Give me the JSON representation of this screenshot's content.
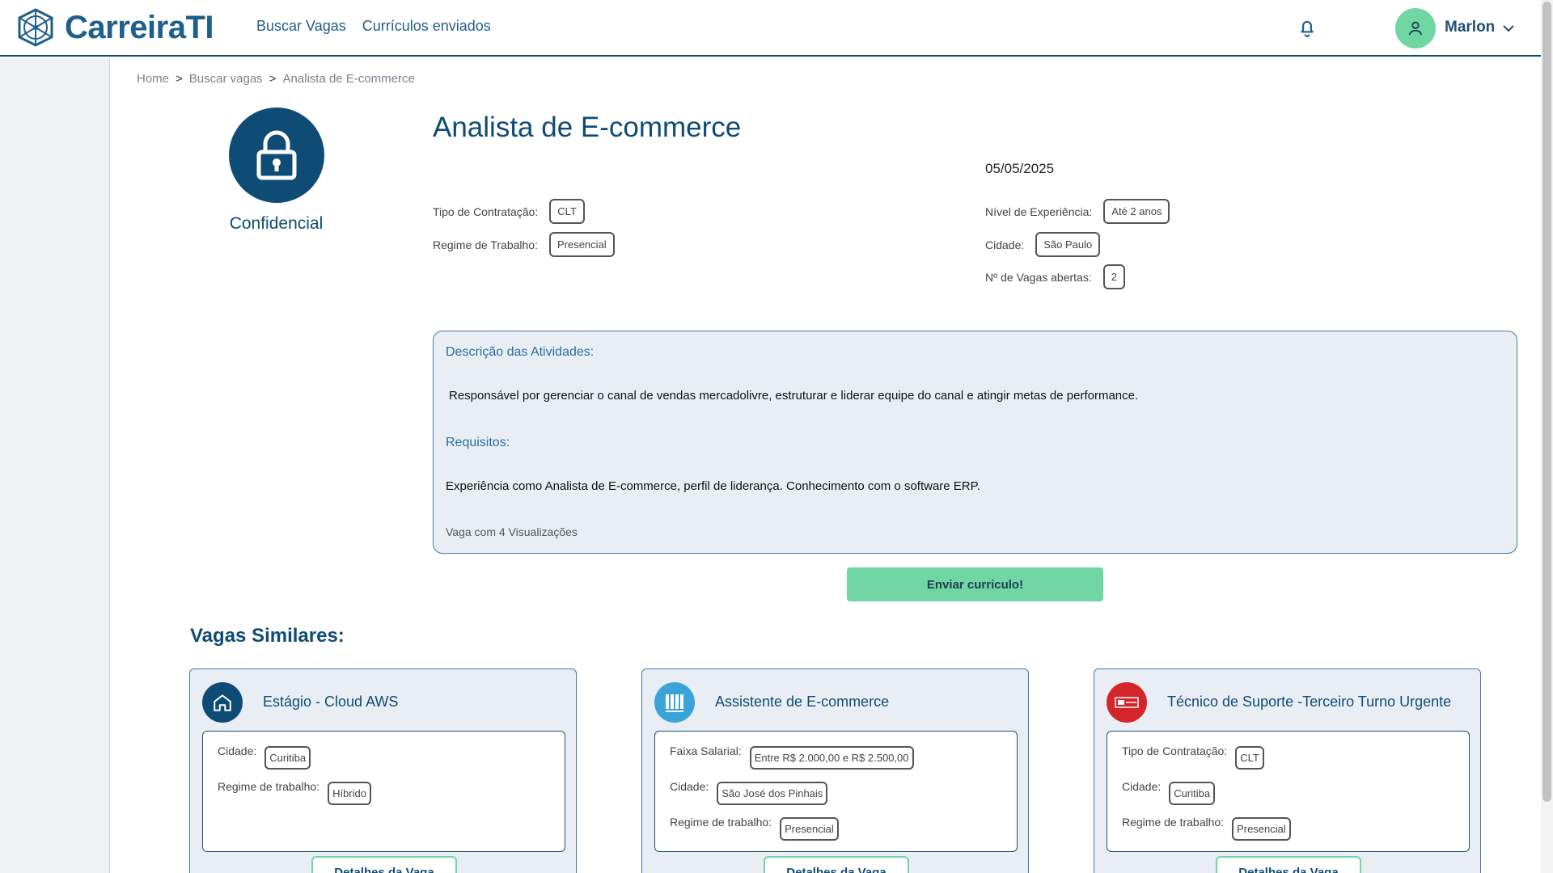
{
  "header": {
    "brand": "CarreiraTI",
    "nav": [
      "Buscar Vagas",
      "Currículos enviados"
    ],
    "user_name": "Marlon",
    "colors": {
      "primary": "#0f4c75",
      "accent": "#6fd6a4"
    }
  },
  "breadcrumb": [
    "Home",
    "Buscar vagas",
    "Analista de E-commerce"
  ],
  "breadcrumb_sep": ">",
  "company": {
    "name": "Confidencial",
    "icon": "lock-icon"
  },
  "job": {
    "title": "Analista de E-commerce",
    "date": "05/05/2025",
    "fields": {
      "tipo_label": "Tipo de Contratação:",
      "tipo_value": "CLT",
      "regime_label": "Regime de Trabalho:",
      "regime_value": "Presencial",
      "nivel_label": "Nível de Experiência:",
      "nivel_value": "Até 2 anos",
      "cidade_label": "Cidade:",
      "cidade_value": "São Paulo",
      "vagas_label": "Nº de Vagas abertas:",
      "vagas_value": "2"
    },
    "desc_heading": "Descrição das Atividades:",
    "desc_text": "Responsável por gerenciar o canal de vendas mercadolivre, estruturar e liderar equipe do canal e atingir metas de performance.",
    "req_heading": "Requisitos:",
    "req_text": "Experiência como Analista de  E-commerce, perfil de liderança. Conhecimento com o software ERP.",
    "views": "Vaga com 4 Visualizações",
    "send_label": "Enviar curriculo!"
  },
  "similar": {
    "title": "Vagas Similares:",
    "details_label": "Detalhes da Vaga",
    "cards": [
      {
        "title": "Estágio - Cloud AWS",
        "icon": "home-icon",
        "f1_label": "Cidade:",
        "f1_value": "Curitiba",
        "f2_label": "Regime de trabalho:",
        "f2_value": "Híbrido"
      },
      {
        "title": "Assistente de E-commerce",
        "icon": "company-logo",
        "f1_label": "Faixa Salarial:",
        "f1_value": "Entre R$ 2.000,00 e R$ 2.500,00",
        "f2_label": "Cidade:",
        "f2_value": "São José dos Pinhais",
        "f3_label": "Regime de trabalho:",
        "f3_value": "Presencial"
      },
      {
        "title": "Técnico de Suporte -Terceiro Turno Urgente",
        "icon": "company-logo",
        "f1_label": "Tipo de Contratação:",
        "f1_value": "CLT",
        "f2_label": "Cidade:",
        "f2_value": "Curitiba",
        "f3_label": "Regime de trabalho:",
        "f3_value": "Presencial"
      }
    ]
  }
}
